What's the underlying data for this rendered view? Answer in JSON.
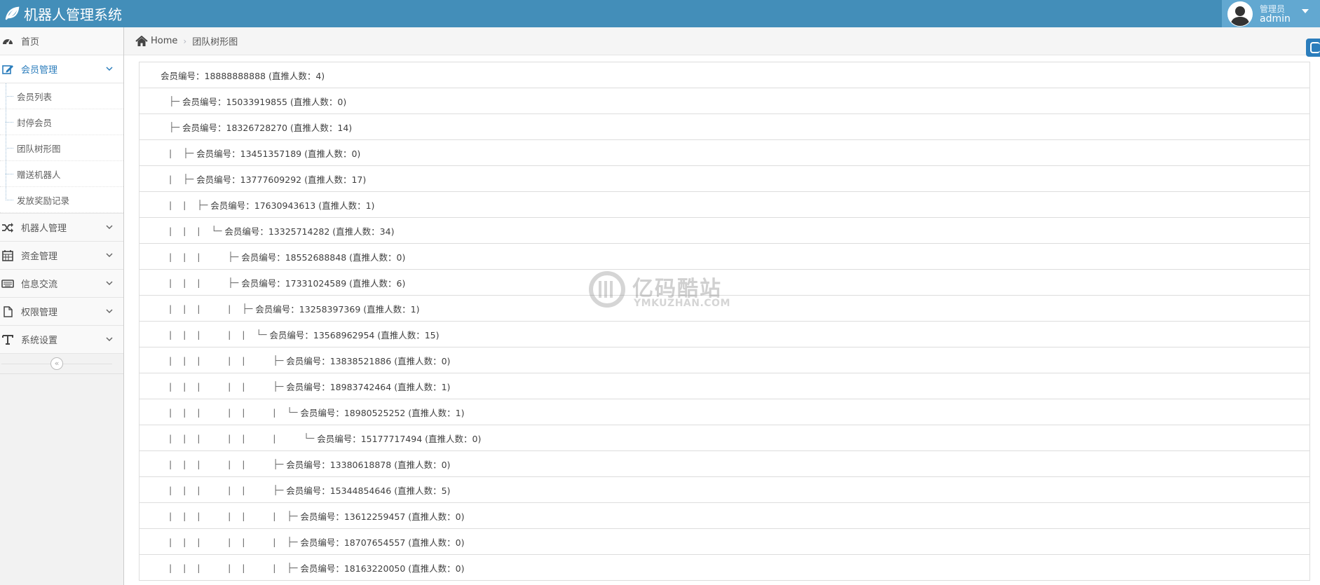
{
  "app": {
    "title": "机器人管理系统",
    "user_role": "管理员",
    "user_name": "admin",
    "brand_color": "#438eb9"
  },
  "sidebar": {
    "items": [
      {
        "label": "首页",
        "icon": "dashboard-icon"
      },
      {
        "label": "会员管理",
        "icon": "edit-icon",
        "active": true,
        "children": [
          "会员列表",
          "封停会员",
          "团队树形图",
          "赠送机器人",
          "发放奖励记录"
        ]
      },
      {
        "label": "机器人管理",
        "icon": "random-icon"
      },
      {
        "label": "资金管理",
        "icon": "calendar-icon"
      },
      {
        "label": "信息交流",
        "icon": "keyboard-icon"
      },
      {
        "label": "权限管理",
        "icon": "file-icon"
      },
      {
        "label": "系统设置",
        "icon": "text-icon"
      }
    ],
    "collapse_glyph": "«"
  },
  "breadcrumb": {
    "home": "Home",
    "separator": "›",
    "current": "团队树形图"
  },
  "tree": {
    "rows": [
      {
        "prefix": "",
        "text": "会员编号：18888888888 (直推人数：4)"
      },
      {
        "prefix": "├─ ",
        "text": "会员编号：15033919855 (直推人数：0)"
      },
      {
        "prefix": "├─ ",
        "text": "会员编号：18326728270 (直推人数：14)"
      },
      {
        "prefix": "|    ├─ ",
        "text": "会员编号：13451357189 (直推人数：0)"
      },
      {
        "prefix": "|    ├─ ",
        "text": "会员编号：13777609292 (直推人数：17)"
      },
      {
        "prefix": "|    |    ├─ ",
        "text": "会员编号：17630943613 (直推人数：1)"
      },
      {
        "prefix": "|    |    |    └─ ",
        "text": "会员编号：13325714282 (直推人数：34)"
      },
      {
        "prefix": "|    |    |          ├─ ",
        "text": "会员编号：18552688848 (直推人数：0)"
      },
      {
        "prefix": "|    |    |          ├─ ",
        "text": "会员编号：17331024589 (直推人数：6)"
      },
      {
        "prefix": "|    |    |          |    ├─ ",
        "text": "会员编号：13258397369 (直推人数：1)"
      },
      {
        "prefix": "|    |    |          |    |    └─ ",
        "text": "会员编号：13568962954 (直推人数：15)"
      },
      {
        "prefix": "|    |    |          |    |          ├─ ",
        "text": "会员编号：13838521886 (直推人数：0)"
      },
      {
        "prefix": "|    |    |          |    |          ├─ ",
        "text": "会员编号：18983742464 (直推人数：1)"
      },
      {
        "prefix": "|    |    |          |    |          |    └─ ",
        "text": "会员编号：18980525252 (直推人数：1)"
      },
      {
        "prefix": "|    |    |          |    |          |          └─ ",
        "text": "会员编号：15177717494 (直推人数：0)"
      },
      {
        "prefix": "|    |    |          |    |          ├─ ",
        "text": "会员编号：13380618878 (直推人数：0)"
      },
      {
        "prefix": "|    |    |          |    |          ├─ ",
        "text": "会员编号：15344854646 (直推人数：5)"
      },
      {
        "prefix": "|    |    |          |    |          |    ├─ ",
        "text": "会员编号：13612259457 (直推人数：0)"
      },
      {
        "prefix": "|    |    |          |    |          |    ├─ ",
        "text": "会员编号：18707654557 (直推人数：0)"
      },
      {
        "prefix": "|    |    |          |    |          |    ├─ ",
        "text": "会员编号：18163220050 (直推人数：0)"
      }
    ]
  },
  "watermark": {
    "title": "亿码酷站",
    "subtitle": "YMKUZHAN.COM"
  }
}
